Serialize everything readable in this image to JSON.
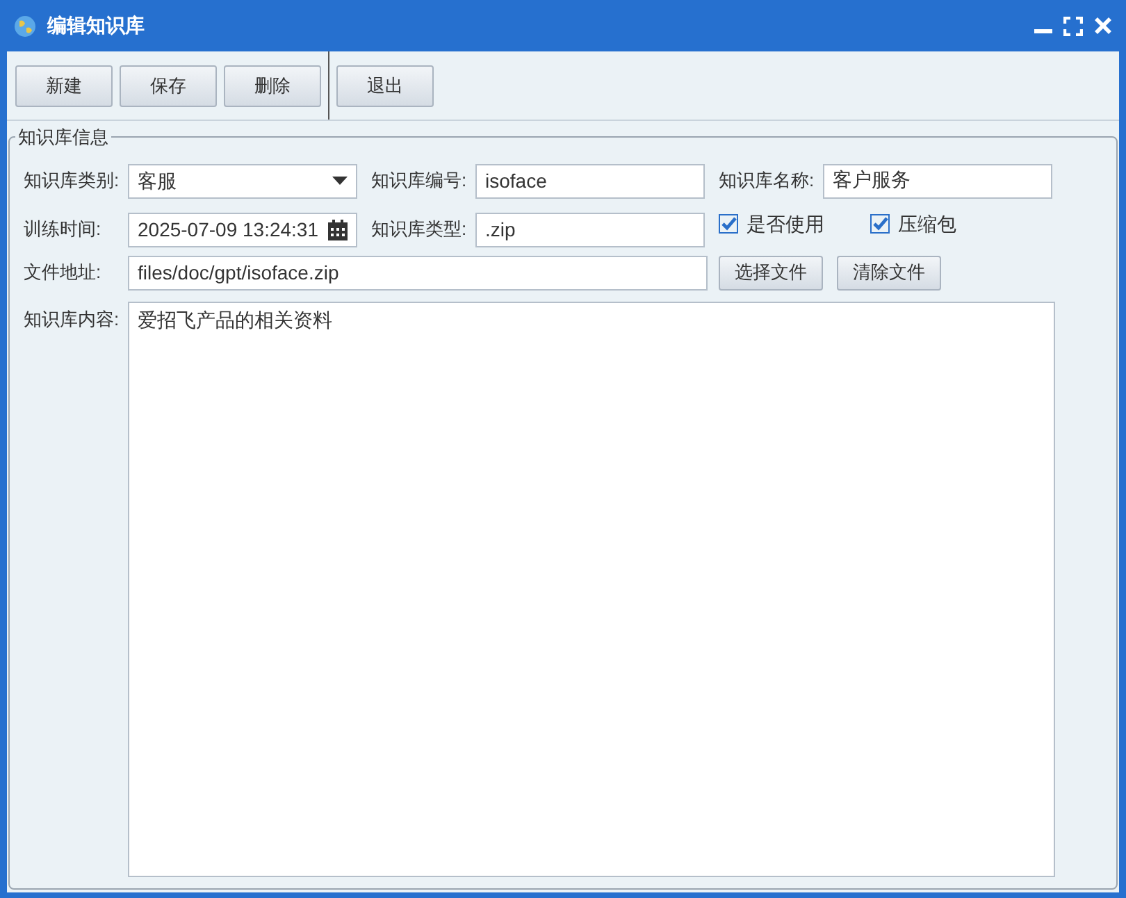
{
  "window": {
    "title": "编辑知识库"
  },
  "toolbar": {
    "groups": [
      [
        "新建",
        "保存",
        "删除"
      ],
      [
        "退出"
      ]
    ]
  },
  "form": {
    "legend": "知识库信息",
    "category": {
      "label": "知识库类别:",
      "value": "客服"
    },
    "code": {
      "label": "知识库编号:",
      "value": "isoface"
    },
    "name": {
      "label": "知识库名称:",
      "value": "客户服务"
    },
    "train_time": {
      "label": "训练时间:",
      "value": "2025-07-09 13:24:31"
    },
    "type": {
      "label": "知识库类型:",
      "value": ".zip"
    },
    "checkboxes": [
      {
        "label": "是否使用",
        "checked": true
      },
      {
        "label": "压缩包",
        "checked": true
      }
    ],
    "file": {
      "label": "文件地址:",
      "value": "files/doc/gpt/isoface.zip"
    },
    "file_buttons": [
      "选择文件",
      "清除文件"
    ],
    "content": {
      "label": "知识库内容:",
      "value": "爱招飞产品的相关资料"
    }
  }
}
